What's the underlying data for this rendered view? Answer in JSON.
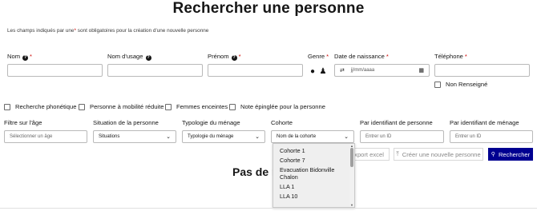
{
  "page": {
    "title": "Rechercher une personne"
  },
  "notice": {
    "before": "Les champs indiqués par une",
    "star": "*",
    "after": "sont obligatoires pour la création d'une nouvelle personne"
  },
  "fields": {
    "nom": {
      "label": "Nom"
    },
    "nom_usage": {
      "label": "Nom d'usage"
    },
    "prenom": {
      "label": "Prénom"
    },
    "genre": {
      "label": "Genre"
    },
    "date_naissance": {
      "label": "Date de naissance",
      "placeholder": "jj/mm/aaaa"
    },
    "telephone": {
      "label": "Téléphone"
    },
    "non_renseigne": {
      "label": "Non Renseigné"
    }
  },
  "checkboxes": {
    "phonetique": "Recherche phonétique",
    "mobilite": "Personne à mobilité réduite",
    "enceintes": "Femmes enceintes",
    "note": "Note épinglée pour la personne"
  },
  "filters": {
    "age": {
      "label": "Filtre sur l'âge",
      "placeholder": "Sélectionner un âge"
    },
    "situation": {
      "label": "Situation de la personne",
      "value": "Situations"
    },
    "menage": {
      "label": "Typologie du ménage",
      "value": "Typologie du ménage"
    },
    "cohorte": {
      "label": "Cohorte",
      "value": "Nom de la cohorte"
    },
    "id_personne": {
      "label": "Par identifiant de personne",
      "placeholder": "Entrer un ID"
    },
    "id_menage": {
      "label": "Par identifiant de ménage",
      "placeholder": "Entrer un ID"
    }
  },
  "actions": {
    "export": "Export excel",
    "create": "Créer une nouvelle personne",
    "search": "Rechercher"
  },
  "results": {
    "heading_visible": "Pas de r"
  },
  "dropdown": {
    "options": [
      "Cohorte 1",
      "Cohorte 7",
      "Evacuation Bidonville Chalon",
      "LLA 1",
      "LLA 10"
    ]
  },
  "colors": {
    "primary": "#000091",
    "required": "#ce0500"
  }
}
